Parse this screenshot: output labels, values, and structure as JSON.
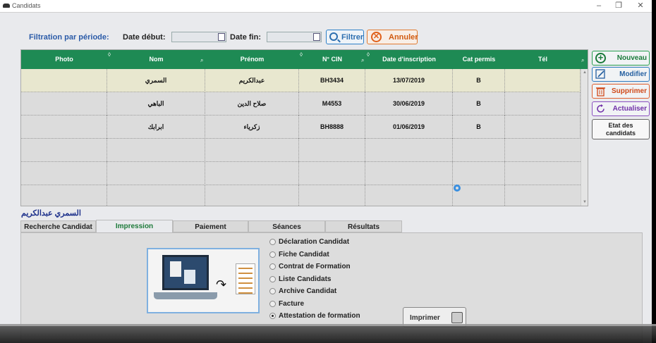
{
  "window": {
    "title": "Candidats"
  },
  "filter": {
    "label": "Filtration par période:",
    "date_debut_label": "Date début:",
    "date_fin_label": "Date fin:",
    "filtrer_label": "Filtrer",
    "annuler_label": "Annuler"
  },
  "grid": {
    "columns": [
      "Photo",
      "Nom",
      "Prénom",
      "N° CIN",
      "Date d'inscription",
      "Cat permis",
      "Tél"
    ],
    "rows": [
      {
        "photo": "",
        "nom": "السمري",
        "prenom": "عبدالكريم",
        "cin": "BH3434",
        "date": "13/07/2019",
        "cat": "B",
        "tel": ""
      },
      {
        "photo": "",
        "nom": "الباهي",
        "prenom": "صلاح الدين",
        "cin": "M4553",
        "date": "30/06/2019",
        "cat": "B",
        "tel": ""
      },
      {
        "photo": "",
        "nom": "ابرابك",
        "prenom": "زكرياء",
        "cin": "BH8888",
        "date": "01/06/2019",
        "cat": "B",
        "tel": ""
      }
    ]
  },
  "actions": {
    "nouveau": "Nouveau",
    "modifier": "Modifier",
    "supprimer": "Supprimer",
    "actualiser": "Actualiser",
    "etat_line1": "Etat des",
    "etat_line2": "candidats"
  },
  "selected_candidate": "السمري  عبدالكريم",
  "tabs": [
    "Recherche  Candidat",
    "Impression",
    "Paiement",
    "Séances",
    "Résultats"
  ],
  "active_tab": "Impression",
  "print_options": [
    {
      "label": "Déclaration Candidat",
      "checked": false
    },
    {
      "label": "Fiche Candidat",
      "checked": false
    },
    {
      "label": "Contrat de Formation",
      "checked": false
    },
    {
      "label": "Liste Candidats",
      "checked": false
    },
    {
      "label": "Archive Candidat",
      "checked": false
    },
    {
      "label": "Facture",
      "checked": false
    },
    {
      "label": "Attestation de formation",
      "checked": true
    }
  ],
  "imprimer_label": "Imprimer",
  "colors": {
    "header_green": "#1e8a54",
    "selected_row": "#e8e7cf",
    "filter_blue": "#2d6fb0",
    "annuler_orange": "#d05a10"
  },
  "icons": [
    "search-icon",
    "cancel-icon",
    "plus-icon",
    "edit-icon",
    "trash-icon",
    "refresh-icon",
    "printer-icon",
    "calendar-icon"
  ]
}
